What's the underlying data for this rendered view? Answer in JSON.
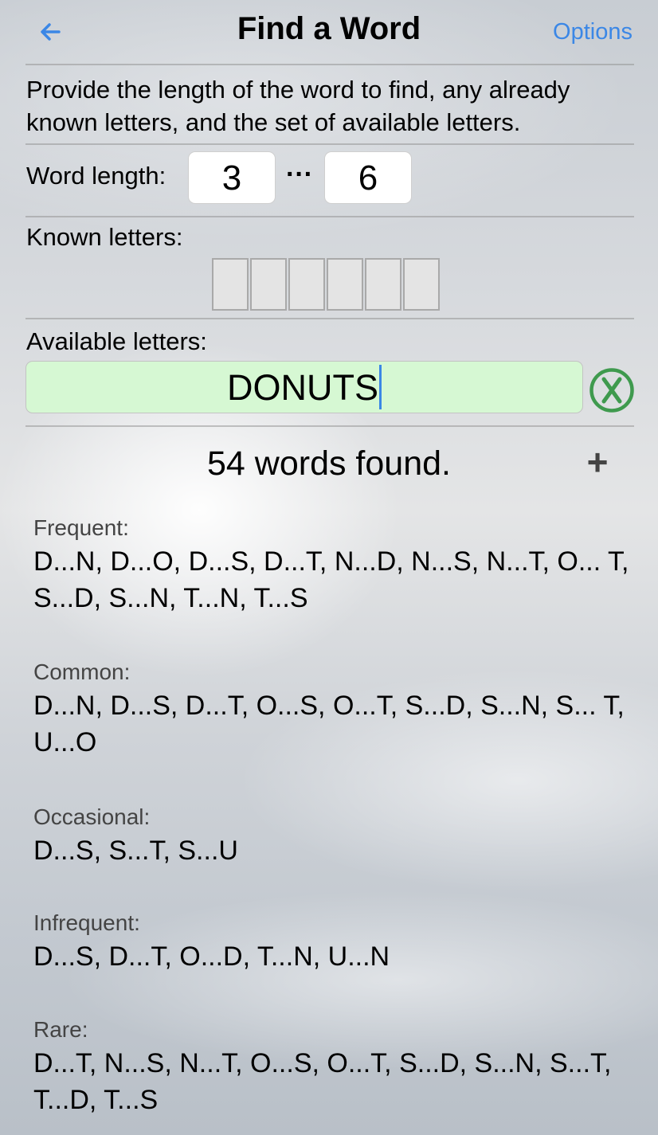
{
  "nav": {
    "title": "Find a Word",
    "options_label": "Options",
    "back_icon": "back-arrow-icon",
    "accent": "#3b87e6"
  },
  "intro": "Provide the length of the word to find, any already known letters, and the set of available letters.",
  "word_length": {
    "label": "Word length:",
    "min": "3",
    "separator": "···",
    "max": "6"
  },
  "known_letters": {
    "label": "Known letters:",
    "cells": [
      "",
      "",
      "",
      "",
      "",
      ""
    ]
  },
  "available_letters": {
    "label": "Available letters:",
    "value": "DONUTS",
    "input_color": "#d6f8d3",
    "clear_icon": "clear-x-circle-icon",
    "clear_color": "#3f9a4e"
  },
  "results": {
    "count_text": "54 words found.",
    "expand_label": "+",
    "groups": [
      {
        "label": "Frequent:",
        "words": "D...N, D...O, D...S, D...T, N...D, N...S, N...T, O... T, S...D, S...N, T...N, T...S"
      },
      {
        "label": "Common:",
        "words": "D...N, D...S, D...T, O...S, O...T, S...D, S...N, S... T, U...O"
      },
      {
        "label": "Occasional:",
        "words": "D...S, S...T, S...U"
      },
      {
        "label": "Infrequent:",
        "words": "D...S, D...T, O...D, T...N, U...N"
      },
      {
        "label": "Rare:",
        "words": "D...T, N...S, N...T, O...S, O...T, S...D, S...N, S...T, T...D, T...S"
      }
    ]
  }
}
